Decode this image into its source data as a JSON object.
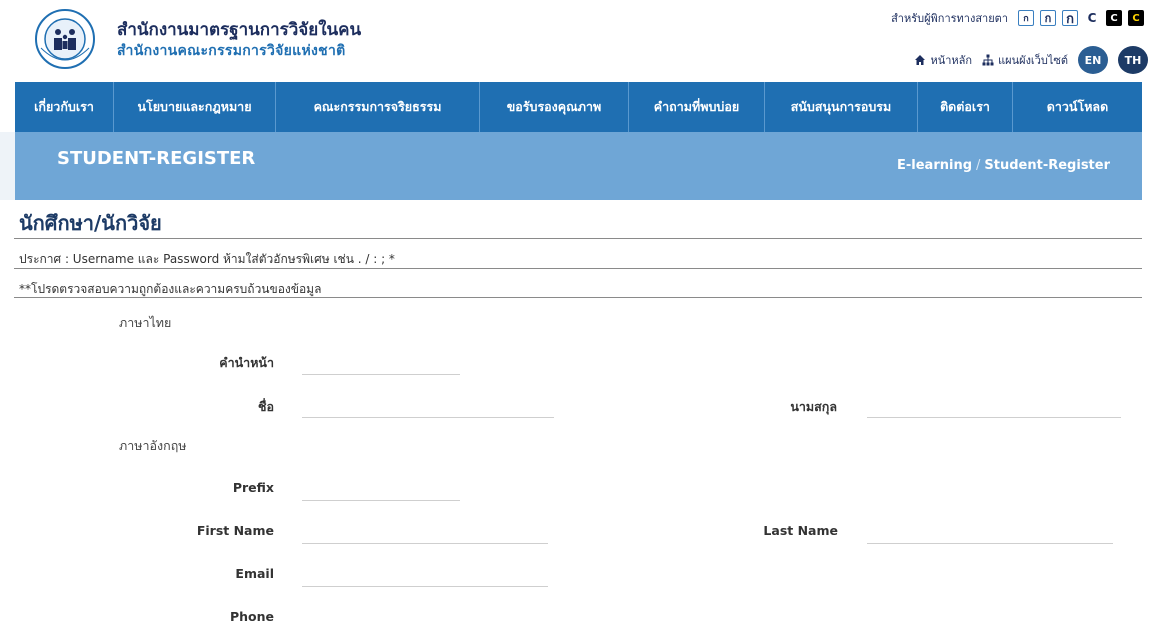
{
  "header": {
    "org_title": "สำนักงานมาตรฐานการวิจัยในคน",
    "org_subtitle": "สำนักงานคณะกรรมการวิจัยแห่งชาติ",
    "accessibility_label": "สำหรับผู้พิการทางสายตา",
    "font_buttons": [
      "ก",
      "ก",
      "ก"
    ],
    "contrast_buttons": [
      "C",
      "C",
      "C"
    ],
    "home_link": "หน้าหลัก",
    "sitemap_link": "แผนผังเว็บไซต์",
    "lang_en": "EN",
    "lang_th": "TH"
  },
  "nav": {
    "items": [
      "เกี่ยวกับเรา",
      "นโยบายและกฎหมาย",
      "คณะกรรมการจริยธรรม",
      "ขอรับรองคุณภาพ",
      "คำถามที่พบบ่อย",
      "สนับสนุนการอบรม",
      "ติดต่อเรา",
      "ดาวน์โหลด"
    ]
  },
  "band": {
    "title": "STUDENT-REGISTER",
    "breadcrumb": [
      "E-learning",
      "Student-Register"
    ],
    "separator": "/"
  },
  "content": {
    "heading": "นักศึกษา/นักวิจัย",
    "notice": "ประกาศ : Username และ Password ห้ามใส่ตัวอักษรพิเศษ เช่น . / : ; *",
    "note": "**โปรดตรวจสอบความถูกต้องและความครบถ้วนของข้อมูล"
  },
  "form": {
    "thai_section": "ภาษาไทย",
    "english_section": "ภาษาอังกฤษ",
    "labels": {
      "th_prefix": "คำนำหน้า",
      "th_first_name": "ชื่อ",
      "th_last_name": "นามสกุล",
      "prefix": "Prefix",
      "first_name": "First Name",
      "last_name": "Last Name",
      "email": "Email",
      "phone": "Phone"
    }
  },
  "colors": {
    "nav_bg": "#1f6fb2",
    "band_bg": "#6fa6d6",
    "heading": "#1d3b66"
  }
}
